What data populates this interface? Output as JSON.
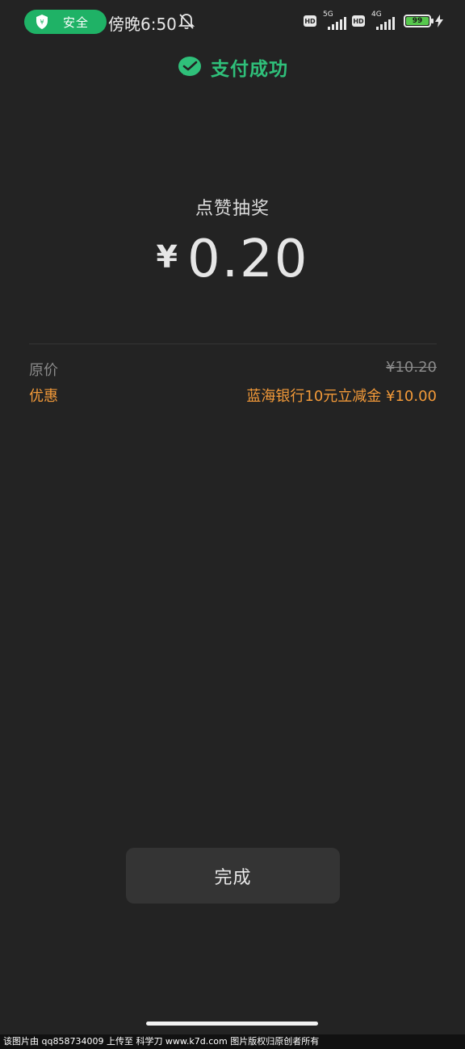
{
  "status_bar": {
    "safety_label": "安全",
    "time": "傍晚6:50",
    "hd_label": "HD",
    "network_1": "5G",
    "network_2": "4G",
    "battery_level": "99",
    "safety_color": "#1fb266",
    "battery_color": "#57c84d"
  },
  "header": {
    "title": "支付成功",
    "icon": "wechat-pay-check-icon",
    "accent_color": "#2fc07a"
  },
  "payment": {
    "merchant": "点赞抽奖",
    "currency_symbol": "¥",
    "amount": "0.20"
  },
  "details": {
    "original_label": "原价",
    "original_price": "¥10.20",
    "discount_label": "优惠",
    "discount_desc": "蓝海银行10元立减金 ¥10.00",
    "discount_color": "#f39a39"
  },
  "actions": {
    "done_label": "完成"
  },
  "footer": {
    "watermark": "该图片由  qq858734009  上传至  科学刀  www.k7d.com  图片版权归原创者所有"
  }
}
